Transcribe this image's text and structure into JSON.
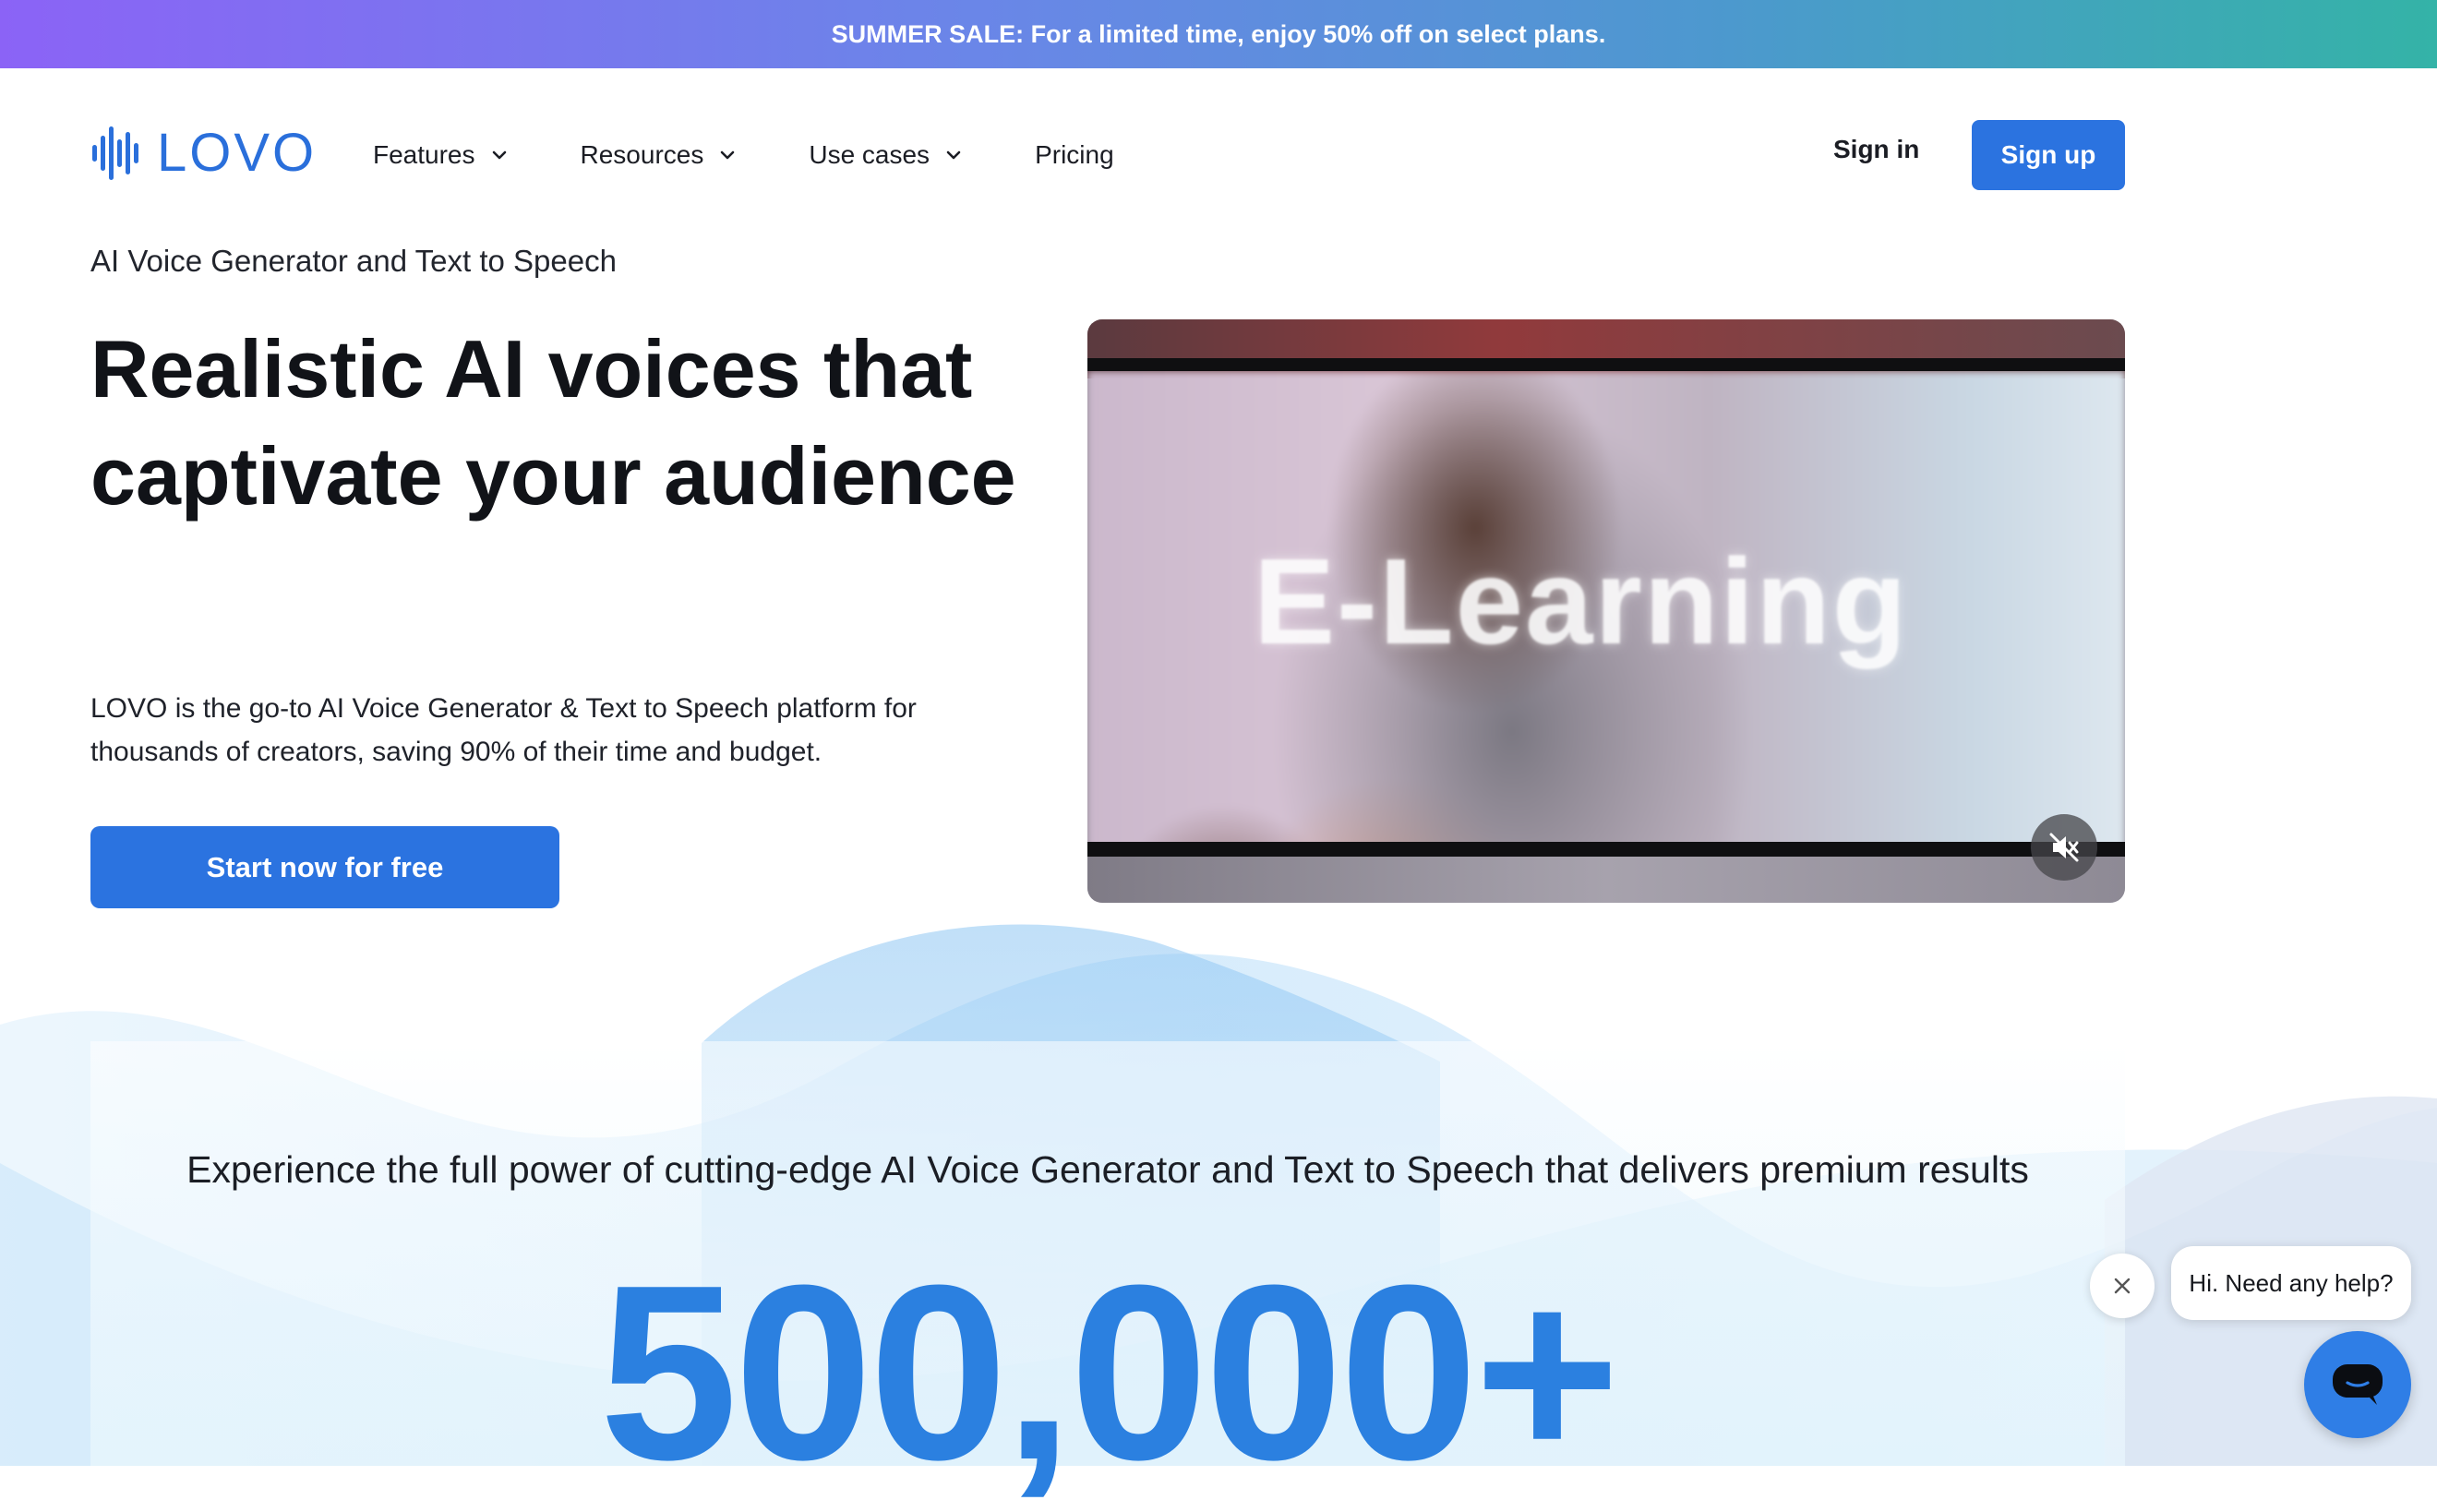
{
  "promo": {
    "text": "SUMMER SALE: For a limited time, enjoy 50% off on select plans."
  },
  "header": {
    "logo": "LOVO",
    "nav": [
      {
        "label": "Features",
        "dropdown": true
      },
      {
        "label": "Resources",
        "dropdown": true
      },
      {
        "label": "Use cases",
        "dropdown": true
      },
      {
        "label": "Pricing",
        "dropdown": false
      }
    ],
    "sign_in": "Sign in",
    "sign_up": "Sign up"
  },
  "hero": {
    "eyebrow": "AI Voice Generator and Text to Speech",
    "title": "Realistic AI voices that captivate your audience",
    "description": "LOVO is the go-to AI Voice Generator & Text to Speech platform for thousands of creators, saving 90% of their time and budget.",
    "cta": "Start now for free",
    "video_caption": "E-Learning"
  },
  "stats": {
    "headline": "Experience the full power of cutting-edge AI Voice Generator and Text to Speech that delivers premium results",
    "number": "500,000+"
  },
  "chat": {
    "greeting": "Hi. Need any help?"
  },
  "colors": {
    "brand": "#2b73e0",
    "logo": "#2a6fdb",
    "number": "#2b80e0"
  }
}
